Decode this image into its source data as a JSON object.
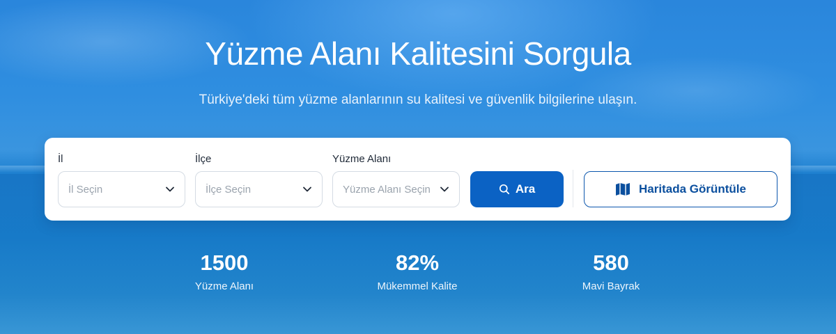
{
  "hero": {
    "title": "Yüzme Alanı Kalitesini Sorgula",
    "subtitle": "Türkiye'deki tüm yüzme alanlarının su kalitesi ve güvenlik bilgilerine ulaşın."
  },
  "search": {
    "fields": [
      {
        "label": "İl",
        "placeholder": "İl Seçin",
        "icon": "chevron-down-icon"
      },
      {
        "label": "İlçe",
        "placeholder": "İlçe Seçin",
        "icon": "chevron-down-icon"
      },
      {
        "label": "Yüzme Alanı",
        "placeholder": "Yüzme Alanı Seçin",
        "icon": "chevron-down-icon"
      }
    ],
    "search_button": {
      "label": "Ara",
      "icon": "search-icon"
    },
    "map_button": {
      "label": "Haritada Görüntüle",
      "icon": "map-icon"
    }
  },
  "stats": [
    {
      "value": "1500",
      "label": "Yüzme Alanı"
    },
    {
      "value": "82%",
      "label": "Mükemmel Kalite"
    },
    {
      "value": "580",
      "label": "Mavi Bayrak"
    }
  ],
  "colors": {
    "primary": "#0b62c4",
    "primary_dark": "#0b4f9e",
    "background_sky": "#2f8ee0",
    "card": "#ffffff"
  }
}
